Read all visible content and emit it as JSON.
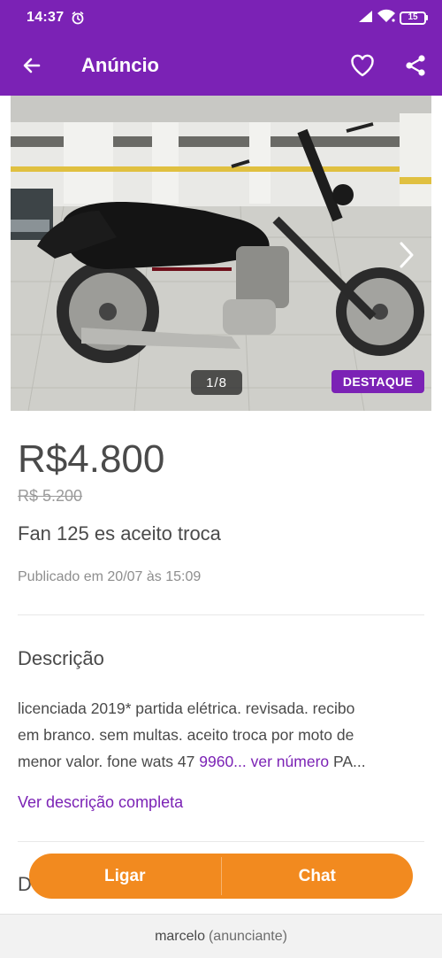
{
  "status_bar": {
    "time": "14:37",
    "battery": "15"
  },
  "app_bar": {
    "title": "Anúncio"
  },
  "gallery": {
    "counter": "1/8",
    "badge": "DESTAQUE"
  },
  "listing": {
    "price": "R$4.800",
    "old_price": "R$ 5.200",
    "title": "Fan 125 es aceito troca",
    "published": "Publicado em 20/07 às 15:09"
  },
  "description": {
    "heading": "Descrição",
    "line1": "licenciada 2019* partida elétrica. revisada. recibo",
    "line2": "em branco. sem multas. aceito troca por moto de",
    "line3_prefix": "menor valor. fone wats 47 ",
    "line3_number": "9960... ver número",
    "line3_suffix": " PA...",
    "see_more": "Ver descrição completa"
  },
  "next_section_initial": "D",
  "actions": {
    "call": "Ligar",
    "chat": "Chat"
  },
  "footer": {
    "name": "marcelo",
    "role": "(anunciante)"
  },
  "colors": {
    "brand_purple": "#7b22b5",
    "cta_orange": "#f28a1f"
  }
}
